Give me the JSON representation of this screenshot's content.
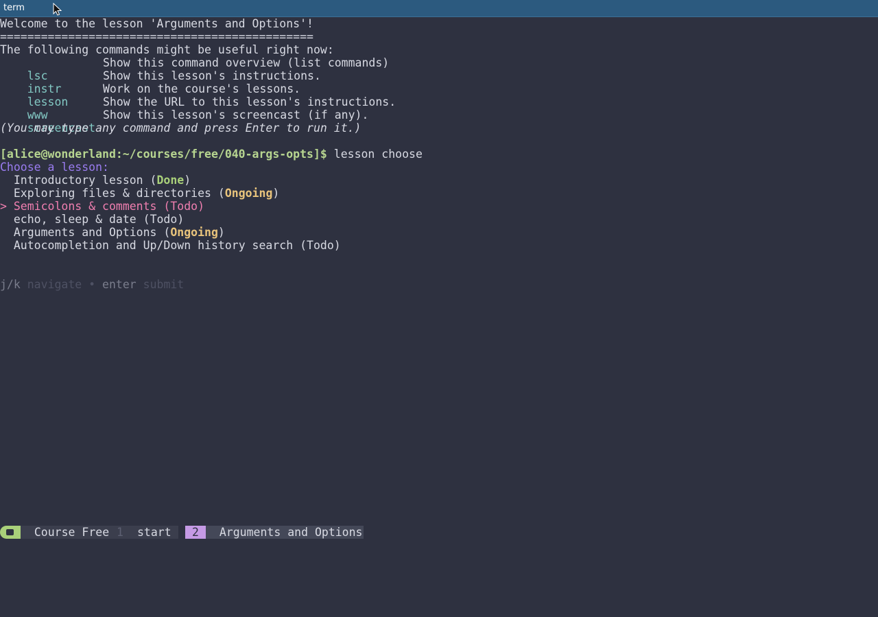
{
  "window": {
    "title": "term"
  },
  "terminal": {
    "welcome": "Welcome to the lesson 'Arguments and Options'!",
    "rule": "==============================================",
    "intro": "The following commands might be useful right now:",
    "commands": [
      {
        "name": "lsc",
        "desc": "Show this command overview (list commands)"
      },
      {
        "name": "instr",
        "desc": "Show this lesson's instructions."
      },
      {
        "name": "lesson",
        "desc": "Work on the course's lessons."
      },
      {
        "name": "www",
        "desc": "Show the URL to this lesson's instructions."
      },
      {
        "name": "screencast",
        "desc": "Show this lesson's screencast (if any)."
      }
    ],
    "hint": "(You may type any command and press Enter to run it.)",
    "prompt": "[alice@wonderland:~/courses/free/040-args-opts]$",
    "command": " lesson choose",
    "choose_label": "Choose a lesson:",
    "lessons": [
      {
        "title": "Introductory lesson",
        "status": "Done"
      },
      {
        "title": "Exploring files & directories",
        "status": "Ongoing"
      },
      {
        "title": "Semicolons & comments",
        "status": "Todo"
      },
      {
        "title": "echo, sleep & date",
        "status": "Todo"
      },
      {
        "title": "Arguments and Options",
        "status": "Ongoing"
      },
      {
        "title": "Autocompletion and Up/Down history search",
        "status": "Todo"
      }
    ],
    "selected_marker": "> ",
    "help": {
      "nav_key": "j/k",
      "nav_label": " navigate",
      "sep": " • ",
      "submit_key": "enter",
      "submit_label": " submit"
    }
  },
  "statusbar": {
    "session_name": "Course Free",
    "window1_index": "1",
    "window1_name": "start",
    "window2_index": "2",
    "window2_name": "Arguments and Options",
    "accent_green": "#a9d07a",
    "accent_purple": "#c59ae5"
  }
}
